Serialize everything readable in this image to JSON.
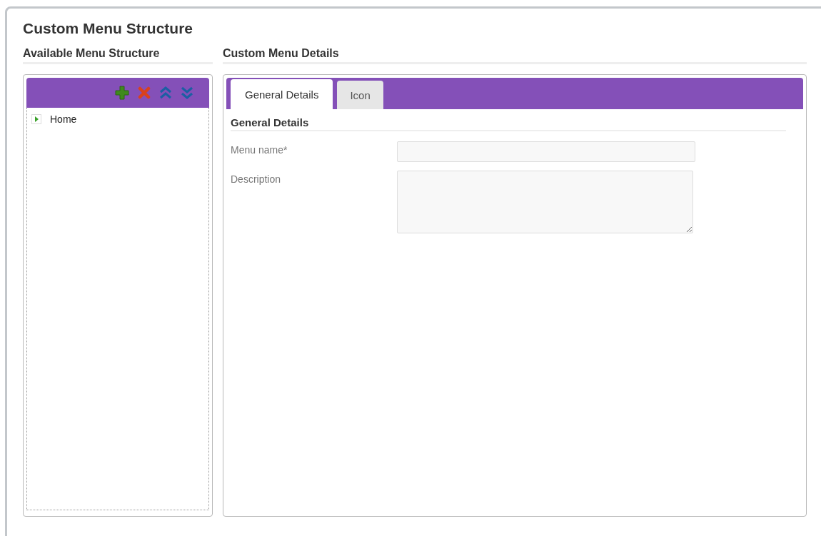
{
  "page": {
    "title": "Custom Menu Structure"
  },
  "structure": {
    "heading": "Available Menu Structure",
    "toolbar": [
      {
        "kind": "add"
      },
      {
        "kind": "delete"
      },
      {
        "kind": "up"
      },
      {
        "kind": "down"
      }
    ],
    "tree": [
      {
        "label": "Home",
        "expanded": false
      }
    ]
  },
  "details": {
    "heading": "Custom Menu Details",
    "tabs": [
      {
        "label": "General Details",
        "selected": true
      },
      {
        "label": "Icon",
        "selected": false
      }
    ],
    "section": "General Details",
    "fields": [
      {
        "label": "Menu name*",
        "kind": "input"
      },
      {
        "label": "Description",
        "kind": "textarea"
      }
    ]
  }
}
